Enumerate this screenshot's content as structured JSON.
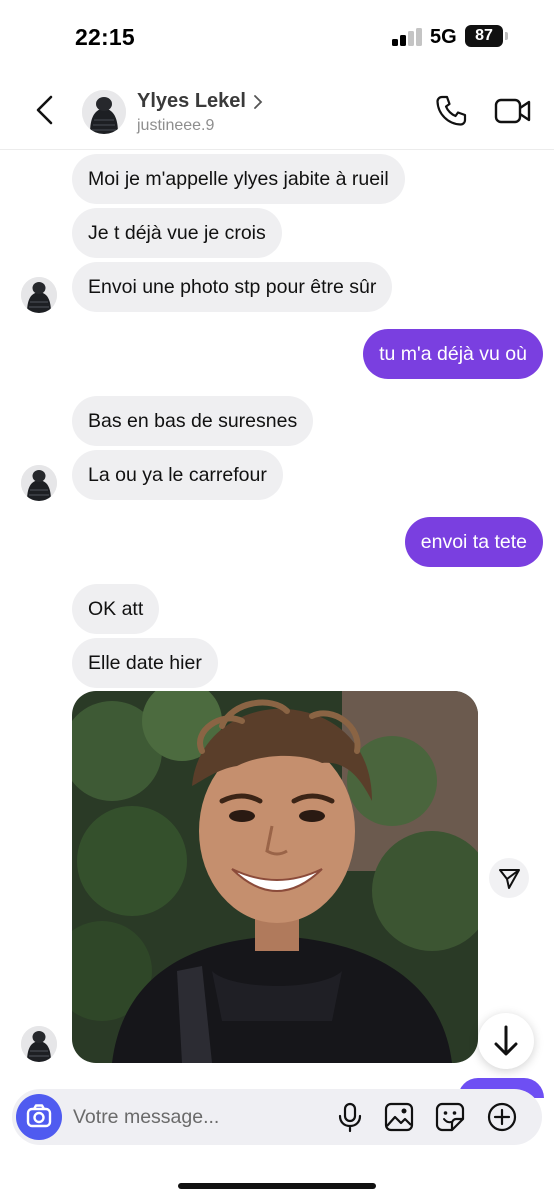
{
  "status_bar": {
    "time": "22:15",
    "network": "5G",
    "battery": "87"
  },
  "header": {
    "name": "Ylyes Lekel",
    "username": "justineee.9"
  },
  "messages": [
    {
      "from": "them",
      "text": "Moi je m'appelle ylyes jabite à rueil"
    },
    {
      "from": "them",
      "text": "Je t déjà vue je crois"
    },
    {
      "from": "them",
      "text": "Envoi une photo stp pour être sûr"
    },
    {
      "from": "me",
      "text": "tu m'a déjà vu où"
    },
    {
      "from": "them",
      "text": "Bas en bas de suresnes"
    },
    {
      "from": "them",
      "text": "La ou ya le carrefour"
    },
    {
      "from": "me",
      "text": "envoi ta tete"
    },
    {
      "from": "them",
      "text": "OK att"
    },
    {
      "from": "them",
      "text": "Elle date hier"
    }
  ],
  "composer": {
    "placeholder": "Votre message..."
  },
  "colors": {
    "outgoing": "#7a3fe0",
    "incoming": "#efeff1",
    "camera_button": "#4f5bf0"
  },
  "icons": [
    "back-icon",
    "chevron-right-icon",
    "phone-icon",
    "video-icon",
    "share-icon",
    "arrow-down-icon",
    "camera-icon",
    "microphone-icon",
    "gallery-icon",
    "sticker-icon",
    "plus-icon"
  ]
}
